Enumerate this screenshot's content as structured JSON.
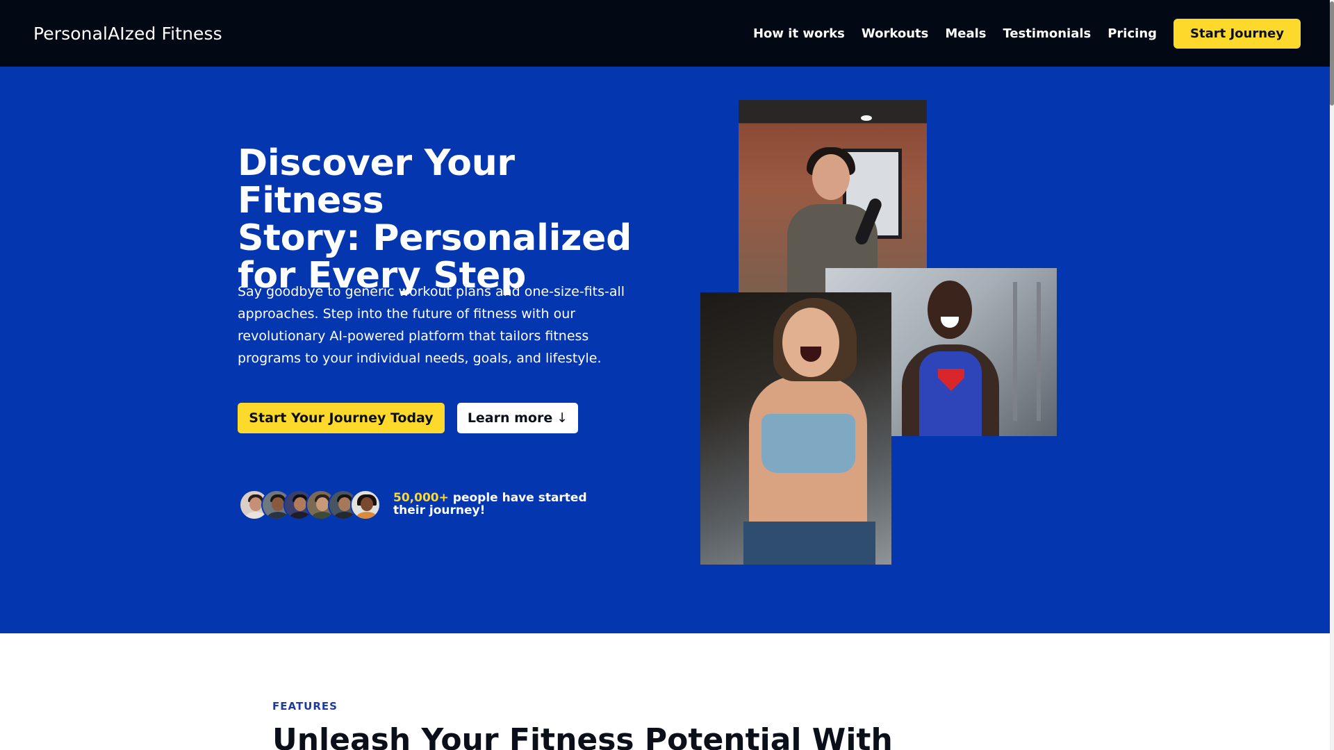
{
  "header": {
    "brand": "PersonalAIzed Fitness",
    "nav": [
      {
        "label": "How it works"
      },
      {
        "label": "Workouts"
      },
      {
        "label": "Meals"
      },
      {
        "label": "Testimonials"
      },
      {
        "label": "Pricing"
      }
    ],
    "cta_label": "Start Journey"
  },
  "hero": {
    "title_lines": [
      "Discover Your Fitness",
      "Story: Personalized",
      "for Every Step"
    ],
    "description_lines": [
      "Say goodbye to generic workout plans and one-size-fits-all",
      "approaches. Step into the future of fitness with our",
      "revolutionary AI-powered platform that tailors fitness",
      "programs to your individual needs, goals, and lifestyle."
    ],
    "primary_button": "Start Your Journey Today",
    "secondary_button": "Learn more",
    "secondary_button_arrow": "↓",
    "social_proof": {
      "count": "50,000+",
      "text": "people have started their journey!"
    }
  },
  "features": {
    "label": "FEATURES",
    "heading": "Unleash Your Fitness Potential With"
  },
  "colors": {
    "header_bg": "#030914",
    "hero_bg": "#0437af",
    "accent_yellow": "#fdd92b",
    "features_label": "#1d3a9e"
  },
  "icons": {
    "learn_more_arrow": "down-arrow-icon"
  }
}
